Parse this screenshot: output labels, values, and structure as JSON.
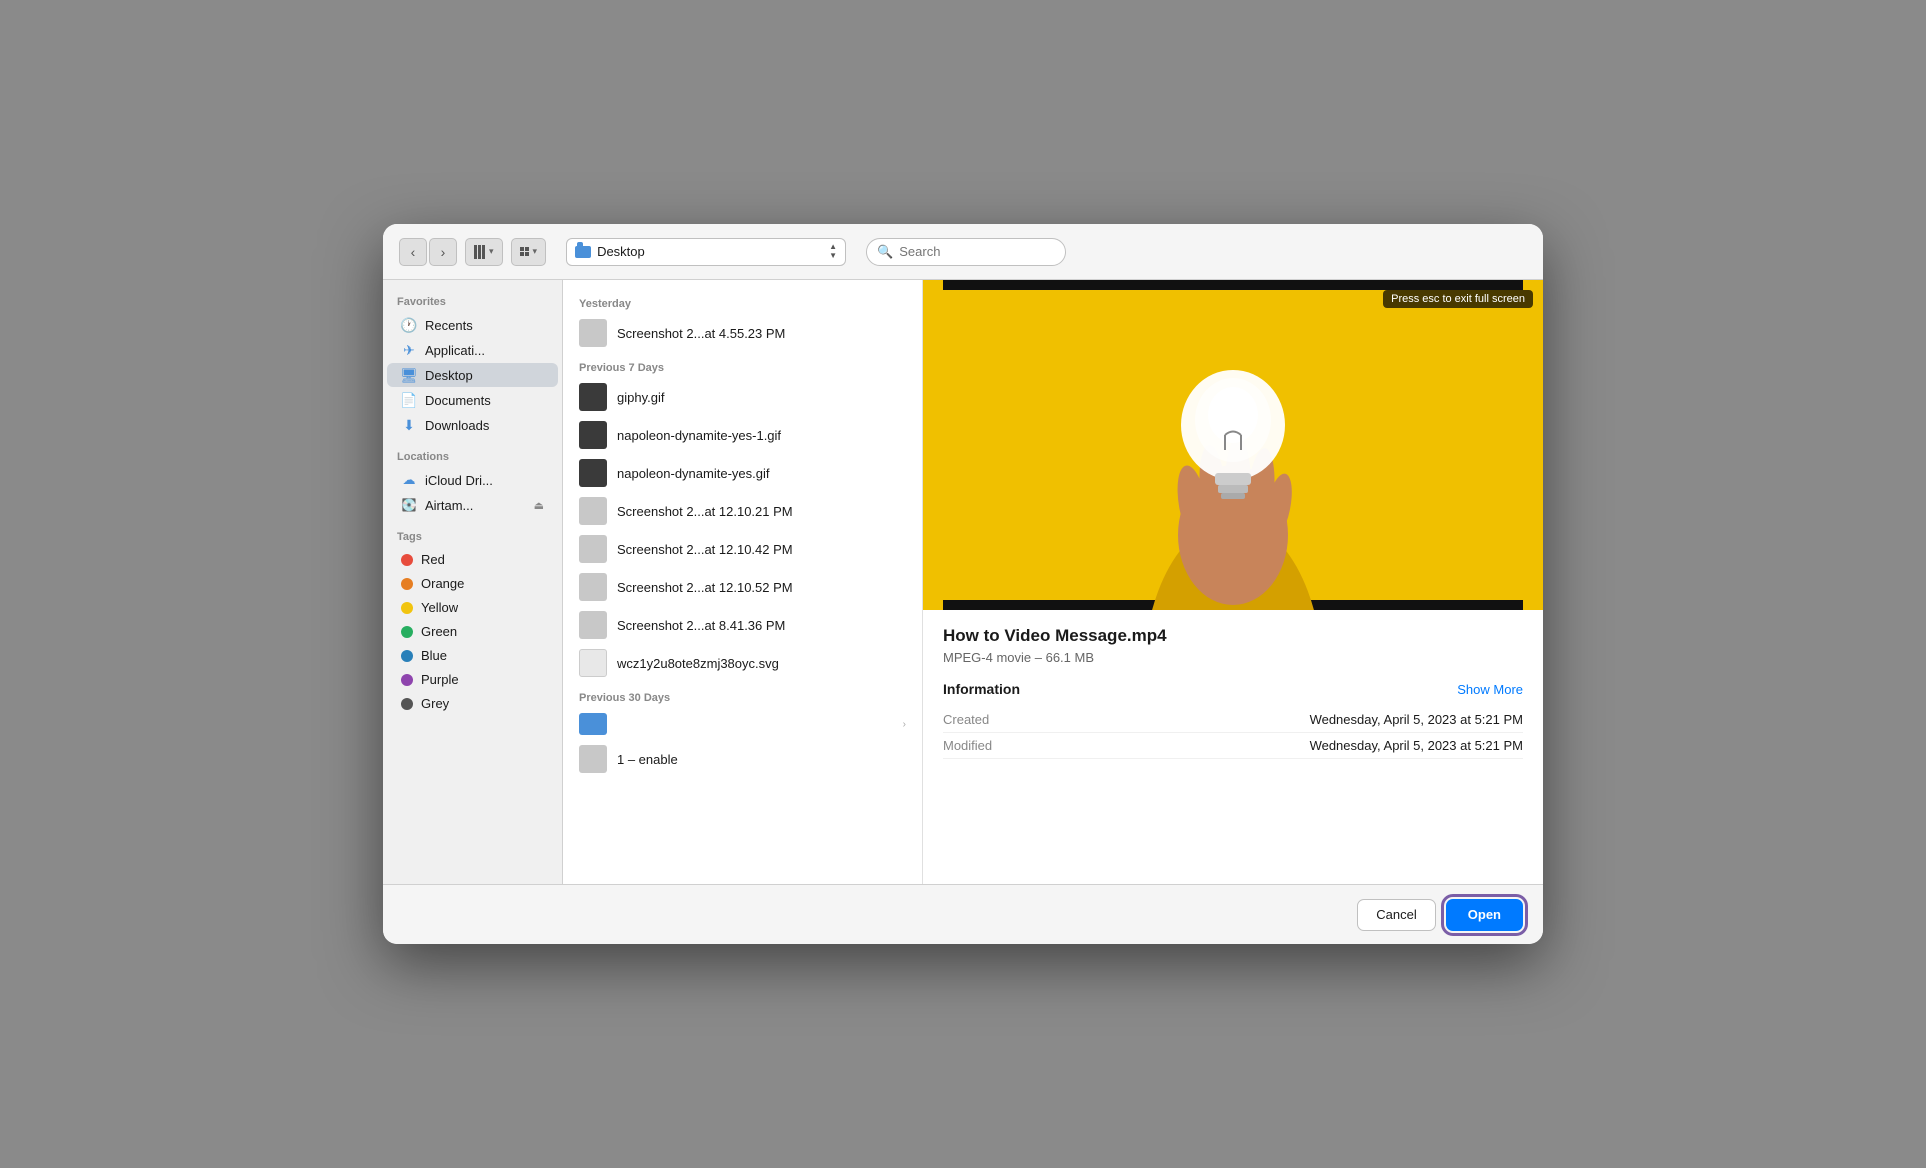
{
  "toolbar": {
    "back_label": "‹",
    "forward_label": "›",
    "location": "Desktop",
    "search_placeholder": "Search"
  },
  "sidebar": {
    "favorites_title": "Favorites",
    "favorites": [
      {
        "id": "recents",
        "label": "Recents",
        "icon": "clock"
      },
      {
        "id": "applications",
        "label": "Applicati...",
        "icon": "rocket"
      },
      {
        "id": "desktop",
        "label": "Desktop",
        "icon": "desktop",
        "active": true
      },
      {
        "id": "documents",
        "label": "Documents",
        "icon": "doc"
      },
      {
        "id": "downloads",
        "label": "Downloads",
        "icon": "download"
      }
    ],
    "locations_title": "Locations",
    "locations": [
      {
        "id": "icloud",
        "label": "iCloud Dri...",
        "icon": "cloud"
      },
      {
        "id": "airtam",
        "label": "Airtam...",
        "icon": "drive",
        "has_eject": true
      }
    ],
    "tags_title": "Tags",
    "tags": [
      {
        "id": "red",
        "label": "Red",
        "color": "#e74c3c"
      },
      {
        "id": "orange",
        "label": "Orange",
        "color": "#e67e22"
      },
      {
        "id": "yellow",
        "label": "Yellow",
        "color": "#f1c40f"
      },
      {
        "id": "green",
        "label": "Green",
        "color": "#27ae60"
      },
      {
        "id": "blue",
        "label": "Blue",
        "color": "#2980b9"
      },
      {
        "id": "purple",
        "label": "Purple",
        "color": "#8e44ad"
      },
      {
        "id": "grey",
        "label": "Grey",
        "color": "#555555"
      }
    ]
  },
  "file_list": {
    "yesterday_header": "Yesterday",
    "yesterday_files": [
      {
        "id": "ss1",
        "name": "Screenshot 2...at 4.55.23 PM",
        "type": "screenshot"
      }
    ],
    "prev7_header": "Previous 7 Days",
    "prev7_files": [
      {
        "id": "giphy",
        "name": "giphy.gif",
        "type": "gif-dark"
      },
      {
        "id": "napoleon1",
        "name": "napoleon-dynamite-yes-1.gif",
        "type": "gif-dark"
      },
      {
        "id": "napoleon2",
        "name": "napoleon-dynamite-yes.gif",
        "type": "gif-dark"
      },
      {
        "id": "ss2",
        "name": "Screenshot 2...at 12.10.21 PM",
        "type": "screenshot"
      },
      {
        "id": "ss3",
        "name": "Screenshot 2...at 12.10.42 PM",
        "type": "screenshot"
      },
      {
        "id": "ss4",
        "name": "Screenshot 2...at 12.10.52 PM",
        "type": "screenshot"
      },
      {
        "id": "ss5",
        "name": "Screenshot 2...at 8.41.36 PM",
        "type": "screenshot"
      },
      {
        "id": "svg1",
        "name": "wcz1y2u8ote8zmj38oyc.svg",
        "type": "svg"
      }
    ],
    "prev30_header": "Previous 30 Days",
    "prev30_files": [
      {
        "id": "folder1",
        "name": "",
        "type": "folder",
        "has_arrow": true
      },
      {
        "id": "enable",
        "name": "1 – enable",
        "type": "screenshot"
      }
    ]
  },
  "preview": {
    "filename": "How to Video Message.mp4",
    "meta": "MPEG-4 movie – 66.1 MB",
    "info_title": "Information",
    "show_more": "Show More",
    "esc_hint": "Press esc to exit full screen",
    "info_rows": [
      {
        "key": "Created",
        "value": "Wednesday, April 5, 2023 at 5:21 PM"
      },
      {
        "key": "Modified",
        "value": "Wednesday, April 5, 2023 at 5:21 PM"
      }
    ]
  },
  "footer": {
    "cancel_label": "Cancel",
    "open_label": "Open"
  }
}
